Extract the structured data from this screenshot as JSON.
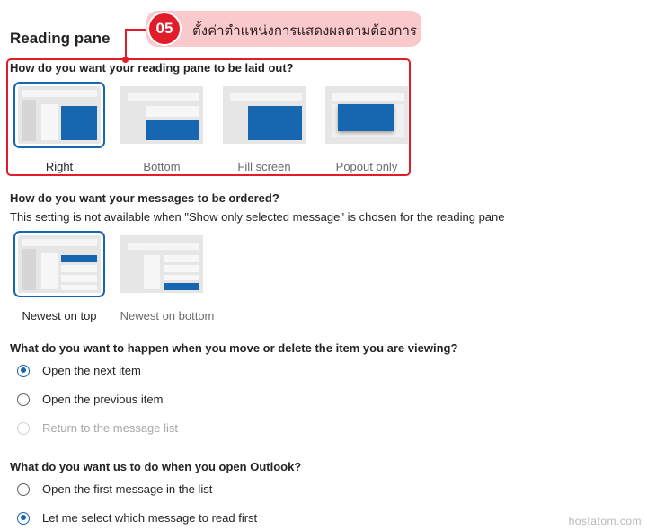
{
  "section": {
    "title": "Reading pane"
  },
  "callout": {
    "badge": "05",
    "text": "ตั้งค่าตำแหน่งการแสดงผลตามต้องการ"
  },
  "layout": {
    "question": "How do you want your reading pane to be laid out?",
    "options": [
      {
        "label": "Right",
        "selected": true
      },
      {
        "label": "Bottom",
        "selected": false
      },
      {
        "label": "Fill screen",
        "selected": false
      },
      {
        "label": "Popout only",
        "selected": false
      }
    ]
  },
  "order": {
    "question": "How do you want your messages to be ordered?",
    "note": "This setting is not available when \"Show only selected message\" is chosen for the reading pane",
    "options": [
      {
        "label": "Newest on top",
        "selected": true
      },
      {
        "label": "Newest on bottom",
        "selected": false
      }
    ]
  },
  "move_delete": {
    "question": "What do you want to happen when you move or delete the item you are viewing?",
    "options": [
      {
        "label": "Open the next item",
        "checked": true,
        "disabled": false
      },
      {
        "label": "Open the previous item",
        "checked": false,
        "disabled": false
      },
      {
        "label": "Return to the message list",
        "checked": false,
        "disabled": true
      }
    ]
  },
  "open_outlook": {
    "question": "What do you want us to do when you open Outlook?",
    "options": [
      {
        "label": "Open the first message in the list",
        "checked": false,
        "disabled": false
      },
      {
        "label": "Let me select which message to read first",
        "checked": true,
        "disabled": false
      }
    ]
  },
  "watermark": "hostatom.com",
  "colors": {
    "accent": "#1766b0",
    "annotation": "#e11d2a",
    "callout_bg": "#f9c9cc"
  }
}
